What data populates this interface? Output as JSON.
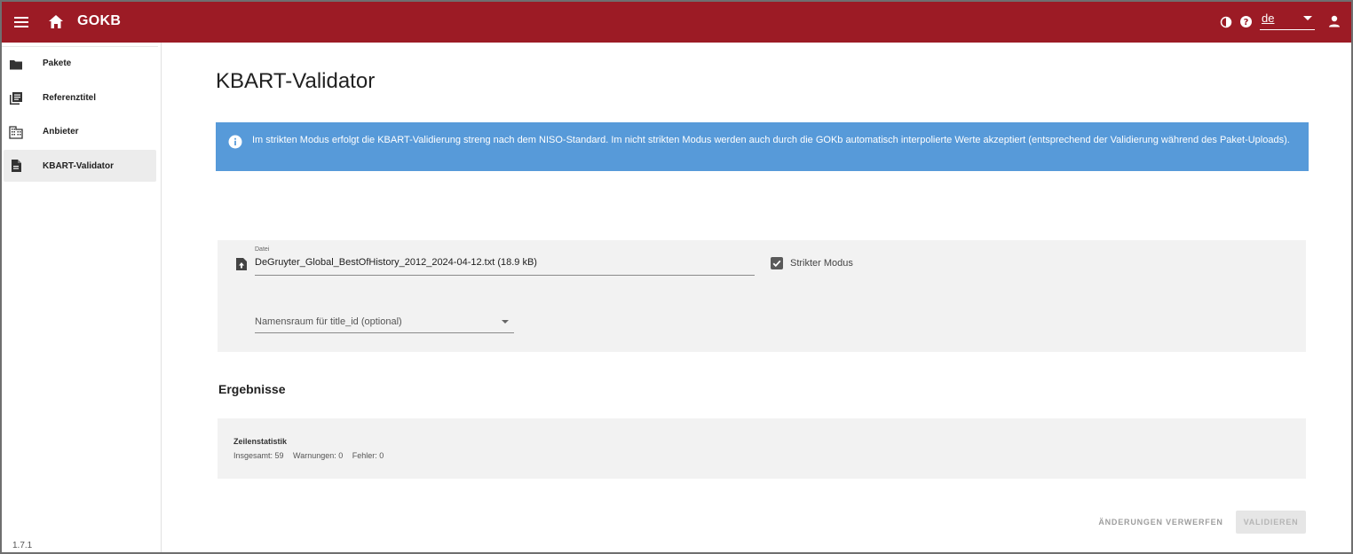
{
  "appbar": {
    "brand": "GOKB",
    "language": "de",
    "colors": {
      "background": "#9c1b25",
      "text": "#ffffff"
    },
    "icons": [
      "menu-icon",
      "home-icon",
      "contrast-icon",
      "help-icon",
      "user-icon"
    ]
  },
  "sidebar": {
    "items": [
      {
        "label": "Pakete",
        "icon": "folder-icon",
        "active": false
      },
      {
        "label": "Referenztitel",
        "icon": "library-books-icon",
        "active": false
      },
      {
        "label": "Anbieter",
        "icon": "domain-icon",
        "active": false
      },
      {
        "label": "KBART-Validator",
        "icon": "file-document-icon",
        "active": true
      }
    ],
    "version": "1.7.1"
  },
  "main": {
    "title": "KBART-Validator",
    "info_alert": {
      "icon": "info-icon",
      "text": "Im strikten Modus erfolgt die KBART-Validierung streng nach dem NISO-Standard. Im nicht strikten Modus werden auch durch die GOKb automatisch interpolierte Werte akzeptiert (entsprechend der Validierung während des Paket-Uploads).",
      "color": "#579ad9"
    },
    "form": {
      "file_label": "Datei",
      "file_value": "DeGruyter_Global_BestOfHistory_2012_2024-04-12.txt (18.9 kB)",
      "file_icon": "file-upload-icon",
      "strict_mode_label": "Strikter Modus",
      "strict_mode_checked": true,
      "namespace_placeholder": "Namensraum für title_id (optional)"
    },
    "results": {
      "title": "Ergebnisse",
      "stats_title": "Zeilenstatistik",
      "total": "Insgesamt: 59",
      "warnings": "Warnungen: 0",
      "errors": "Fehler: 0"
    },
    "actions": {
      "discard_label": "ÄNDERUNGEN VERWERFEN",
      "validate_label": "VALIDIEREN"
    }
  }
}
